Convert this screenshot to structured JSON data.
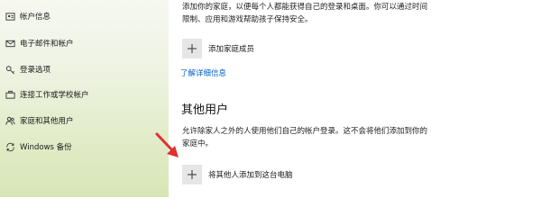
{
  "sidebar": {
    "items": [
      {
        "label": "帐户信息",
        "icon": "user-card-icon"
      },
      {
        "label": "电子邮件和帐户",
        "icon": "envelope-icon"
      },
      {
        "label": "登录选项",
        "icon": "key-icon"
      },
      {
        "label": "连接工作或学校帐户",
        "icon": "briefcase-icon"
      },
      {
        "label": "家庭和其他用户",
        "icon": "people-icon"
      },
      {
        "label": "Windows 备份",
        "icon": "sync-icon"
      }
    ]
  },
  "family": {
    "description_line1": "添加你的家庭，以便每个人都能获得自己的登录和桌面。你可以通过时间",
    "description_line2": "限制、应用和游戏帮助孩子保持安全。",
    "add_label": "添加家庭成员",
    "learn_more": "了解详细信息"
  },
  "other_users": {
    "title": "其他用户",
    "description_line1": "允许除家人之外的人使用他们自己的帐户登录。这不会将他们添加到你的",
    "description_line2": "家庭中。",
    "add_label": "将其他人添加到这台电脑"
  },
  "colors": {
    "link": "#0060c8",
    "annotation_arrow": "#e03030",
    "add_box": "#e6e6e6"
  }
}
